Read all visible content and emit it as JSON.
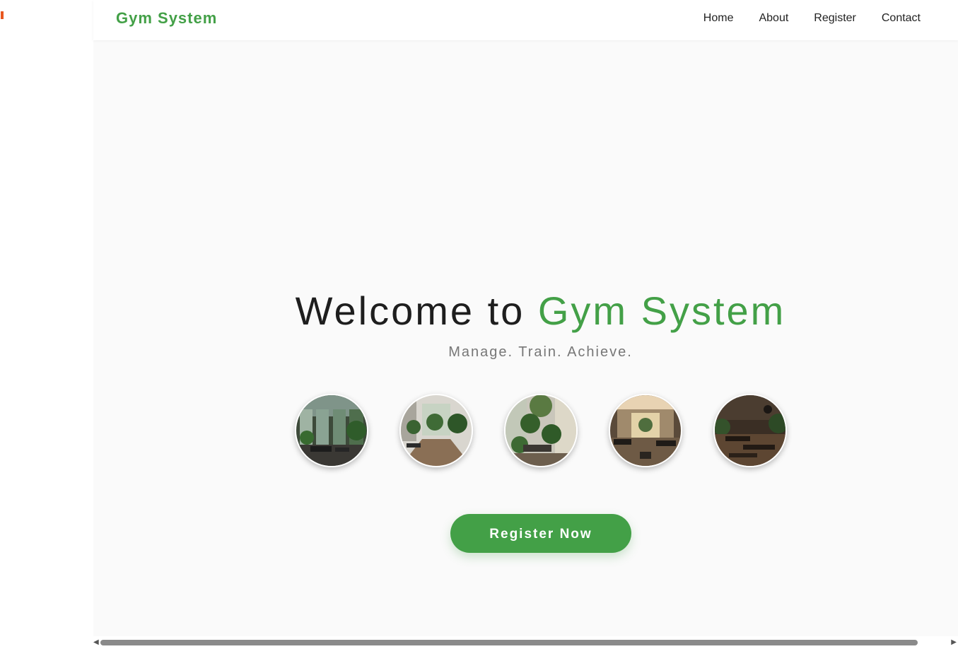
{
  "nav": {
    "brand": "Gym System",
    "links": [
      "Home",
      "About",
      "Register",
      "Contact"
    ]
  },
  "hero": {
    "title_prefix": "Welcome to ",
    "title_accent": "Gym System",
    "subtitle": "Manage. Train. Achieve.",
    "cta_label": "Register Now"
  },
  "gallery": {
    "images": [
      "gym-interior-photo-1",
      "gym-interior-photo-2",
      "gym-interior-photo-3",
      "gym-interior-photo-4",
      "gym-interior-photo-5"
    ]
  },
  "colors": {
    "accent": "#43a047",
    "text": "#1e1e1e",
    "muted": "#777777",
    "background": "#fafafa"
  }
}
